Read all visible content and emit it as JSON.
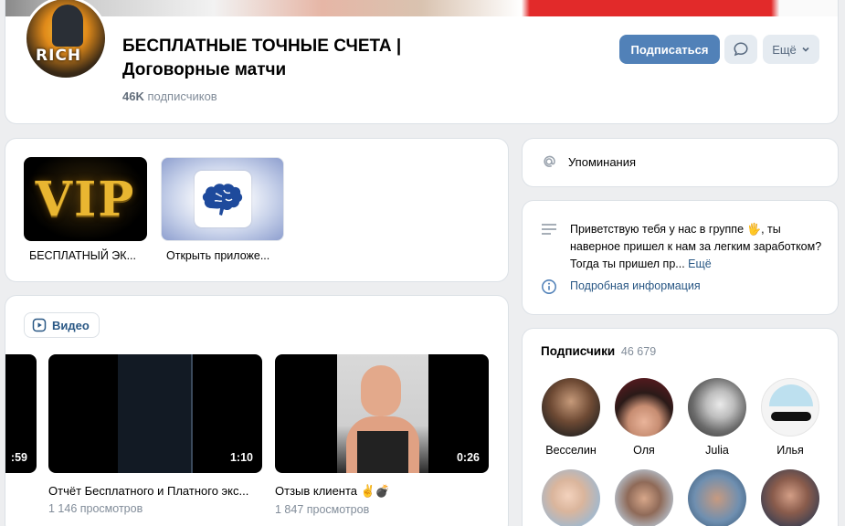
{
  "header": {
    "title_line1": "БЕСПЛАТНЫЕ ТОЧНЫЕ СЧЕТА |",
    "title_line2": "Договорные матчи",
    "subscribers_count": "46K",
    "subscribers_label": "подписчиков",
    "subscribe_button": "Подписаться",
    "more_button": "Ещё",
    "avatar_logo_text": "RICH"
  },
  "apps": [
    {
      "thumb_text": "VIP",
      "label": "БЕСПЛАТНЫЙ ЭК..."
    },
    {
      "icon": "brain-icon",
      "label": "Открыть приложе..."
    }
  ],
  "video_section": {
    "tab_label": "Видео",
    "videos": [
      {
        "duration": ":59",
        "title": "",
        "views": ""
      },
      {
        "duration": "1:10",
        "title": "Отчёт Бесплатного и Платного экс...",
        "views": "1 146 просмотров"
      },
      {
        "duration": "0:26",
        "title": "Отзыв клиента ✌️💣",
        "views": "1 847 просмотров"
      }
    ]
  },
  "mentions": {
    "label": "Упоминания"
  },
  "about": {
    "text": "Приветствую тебя у нас в группе 🖐, ты наверное пришел к нам за легким заработком? Тогда ты пришел пр...",
    "more": "Ещё",
    "info_link": "Подробная информация"
  },
  "followers": {
    "title": "Подписчики",
    "count": "46 679",
    "people": [
      {
        "name": "Весселин"
      },
      {
        "name": "Оля"
      },
      {
        "name": "Julia"
      },
      {
        "name": "Илья"
      },
      {
        "name": ""
      },
      {
        "name": ""
      },
      {
        "name": ""
      },
      {
        "name": ""
      }
    ]
  },
  "colors": {
    "accent": "#5181b8",
    "link": "#2a5885",
    "muted": "#818c99",
    "background": "#edeef0"
  }
}
